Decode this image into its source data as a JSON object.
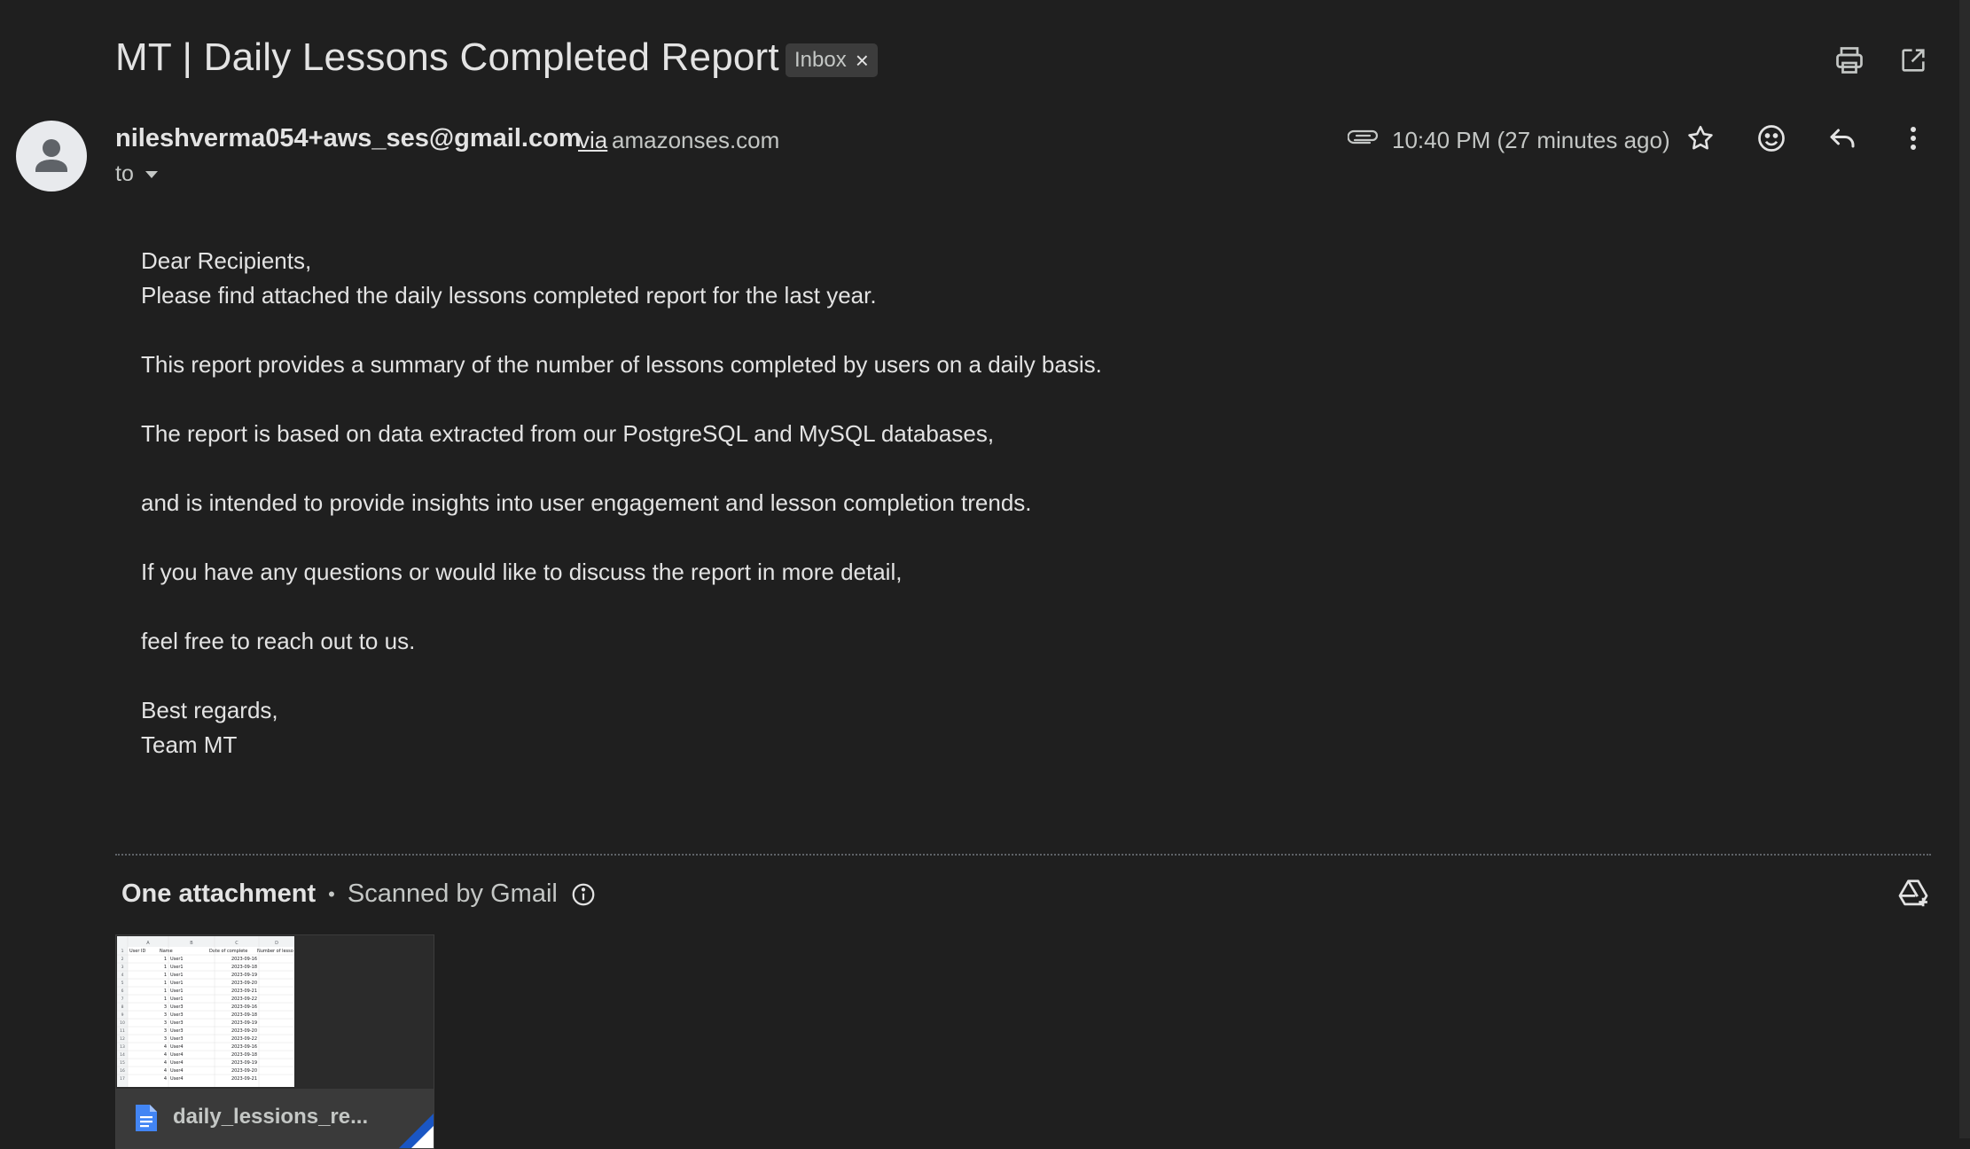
{
  "email": {
    "subject": "MT | Daily Lessons Completed Report",
    "label": "Inbox",
    "label_remove": "×",
    "sender_email": "nileshverma054+aws_ses@gmail.com",
    "via_text": "via",
    "via_domain": "amazonses.com",
    "to_label": "to",
    "timestamp": "10:40 PM (27 minutes ago)",
    "body": [
      "Dear Recipients,",
      "Please find attached the daily lessons completed report for the last year.",
      "",
      "This report provides a summary of the number of lessons completed by users on a daily basis.",
      "",
      "The report is based on data extracted from our PostgreSQL and MySQL databases,",
      "",
      "and is intended to provide insights into user engagement and lesson completion trends.",
      "",
      "If you have any questions or would like to discuss the report in more detail,",
      "",
      "feel free to reach out to us.",
      "",
      "Best regards,",
      "Team MT"
    ]
  },
  "attachments": {
    "heading": "One attachment",
    "separator": "•",
    "scanned_text": "Scanned by Gmail",
    "file_name": "daily_lessions_re...",
    "thumbnail": {
      "columns": [
        "A",
        "B",
        "C",
        "D"
      ],
      "headers": [
        "User ID",
        "Name",
        "Date of complete",
        "Number of lesso"
      ],
      "rows": [
        [
          "1",
          "User1",
          "2023-09-16"
        ],
        [
          "1",
          "User1",
          "2023-09-18"
        ],
        [
          "1",
          "User1",
          "2023-09-19"
        ],
        [
          "1",
          "User1",
          "2023-09-20"
        ],
        [
          "1",
          "User1",
          "2023-09-21"
        ],
        [
          "1",
          "User1",
          "2023-09-22"
        ],
        [
          "3",
          "User3",
          "2023-09-16"
        ],
        [
          "3",
          "User3",
          "2023-09-18"
        ],
        [
          "3",
          "User3",
          "2023-09-19"
        ],
        [
          "3",
          "User3",
          "2023-09-20"
        ],
        [
          "3",
          "User3",
          "2023-09-22"
        ],
        [
          "4",
          "User4",
          "2023-09-16"
        ],
        [
          "4",
          "User4",
          "2023-09-18"
        ],
        [
          "4",
          "User4",
          "2023-09-19"
        ],
        [
          "4",
          "User4",
          "2023-09-20"
        ],
        [
          "4",
          "User4",
          "2023-09-21"
        ]
      ]
    }
  },
  "icons": {
    "print": "print-icon",
    "open_new_window": "open-in-new-window-icon",
    "attachment": "paperclip-icon",
    "star": "star-icon",
    "emoji": "emoji-reaction-icon",
    "reply": "reply-icon",
    "more": "more-vertical-icon",
    "info": "info-icon",
    "drive": "add-to-drive-icon",
    "doc": "document-icon"
  },
  "colors": {
    "background": "#1f1f1f",
    "text": "#e3e3e3",
    "muted": "#c4c7c5",
    "doc_blue": "#4285f4"
  }
}
